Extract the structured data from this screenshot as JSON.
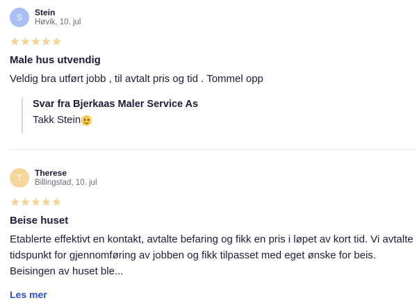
{
  "colors": {
    "star": "#f3d79a",
    "avatar1": "#a9bff5",
    "avatar2": "#f5d79b",
    "link": "#2b4fcf"
  },
  "reviews": [
    {
      "avatar_initial": "S",
      "name": "Stein",
      "location_date": "Høvik, 10. jul",
      "rating": 5,
      "title": "Male hus utvendig",
      "text": "Veldig bra utført jobb , til avtalt pris og tid . Tommel opp",
      "reply": {
        "heading": "Svar fra Bjerkaas Maler Service As",
        "text": "Takk Stein",
        "emoji": "slightly-smiling-face"
      }
    },
    {
      "avatar_initial": "T",
      "name": "Therese",
      "location_date": "Billingstad, 10. jul",
      "rating": 5,
      "title": "Beise huset",
      "text": "Etablerte effektivt en kontakt, avtalte befaring og fikk en pris i løpet av kort tid. Vi avtalte tidspunkt for gjennomføring av jobben og fikk tilpasset med eget ønske for beis. Beisingen av huset ble...",
      "read_more": "Les mer"
    }
  ]
}
